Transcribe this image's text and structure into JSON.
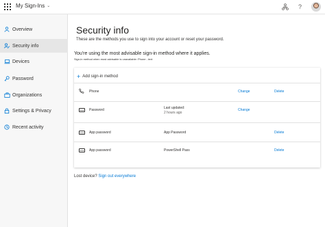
{
  "header": {
    "app_title": "My Sign-Ins",
    "icons": [
      "waffle-icon",
      "chevron-down-icon",
      "organization-icon",
      "help-icon",
      "avatar"
    ],
    "help_glyph": "?"
  },
  "sidebar": {
    "items": [
      {
        "label": "Overview",
        "icon": "person-icon",
        "active": false
      },
      {
        "label": "Security info",
        "icon": "security-info-icon",
        "active": true
      },
      {
        "label": "Devices",
        "icon": "laptop-icon",
        "active": false
      },
      {
        "label": "Password",
        "icon": "key-icon",
        "active": false
      },
      {
        "label": "Organizations",
        "icon": "briefcase-icon",
        "active": false
      },
      {
        "label": "Settings & Privacy",
        "icon": "lock-icon",
        "active": false
      },
      {
        "label": "Recent activity",
        "icon": "history-icon",
        "active": false
      }
    ]
  },
  "main": {
    "title": "Security info",
    "subtitle": "These are the methods you use to sign into your account or reset your password.",
    "default_method_text": "You're using the most advisable sign-in method where it applies.",
    "note": "Sign-in method when most advisable is unavailable: Phone - text",
    "add_method_label": "Add sign-in method",
    "methods": [
      {
        "icon": "phone-icon",
        "method": "Phone",
        "detail": "",
        "detail_sub": "",
        "change": "Change",
        "delete": "Delete"
      },
      {
        "icon": "password-icon",
        "method": "Password",
        "detail": "Last updated:",
        "detail_sub": "2 hours ago",
        "change": "Change",
        "delete": ""
      },
      {
        "icon": "password-icon",
        "method": "App password",
        "detail": "App Password",
        "detail_sub": "",
        "change": "",
        "delete": "Delete"
      },
      {
        "icon": "password-icon",
        "method": "App password",
        "detail": "PowerShell Pass",
        "detail_sub": "",
        "change": "",
        "delete": "Delete"
      }
    ],
    "lost_device_label": "Lost device?",
    "sign_out_everywhere": "Sign out everywhere"
  },
  "colors": {
    "accent": "#0078d4",
    "sidebar_bg": "#f7f7f7",
    "active_item_bg": "#e6e6e6"
  }
}
